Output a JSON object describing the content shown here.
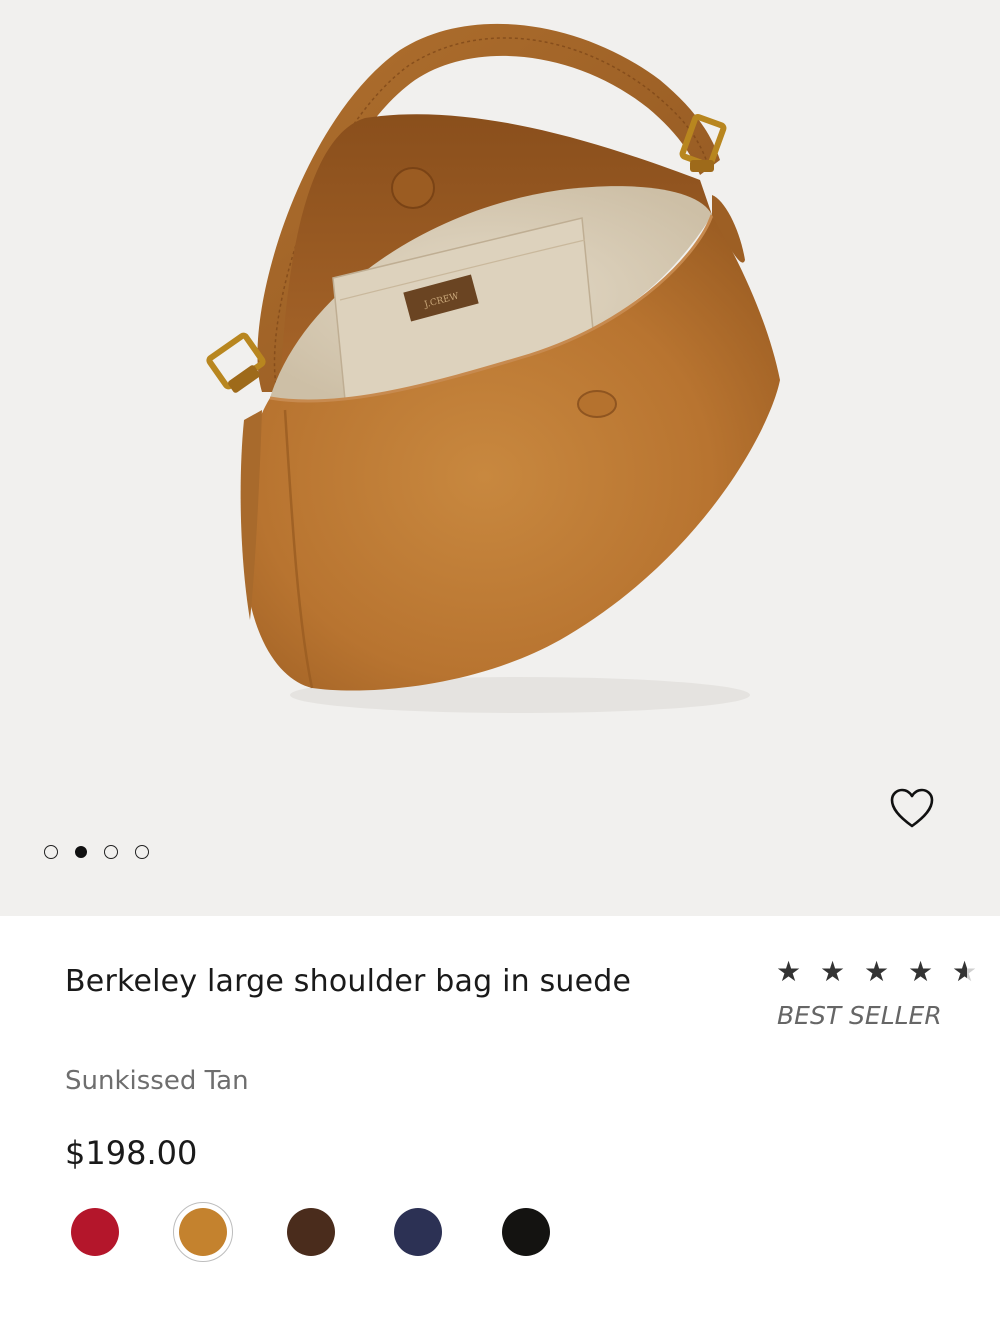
{
  "product": {
    "title": "Berkeley large shoulder bag in suede",
    "color_name": "Sunkissed Tan",
    "price": "$198.00",
    "badge": "BEST SELLER",
    "rating": 4.5,
    "rating_max": 5,
    "stars": {
      "full": "★ ★ ★ ★",
      "half": "★"
    },
    "bag_label": "J.CREW"
  },
  "gallery": {
    "slide_count": 4,
    "active_index": 1,
    "wishlist_icon": "heart-outline-icon",
    "background": "#f1f0ee"
  },
  "swatches": [
    {
      "name": "red",
      "color": "#b4162b",
      "selected": false
    },
    {
      "name": "sunkissed-tan",
      "color": "#c4822e",
      "selected": true
    },
    {
      "name": "brown",
      "color": "#4a2c1c",
      "selected": false
    },
    {
      "name": "navy",
      "color": "#2c3154",
      "selected": false
    },
    {
      "name": "black",
      "color": "#141311",
      "selected": false
    }
  ]
}
